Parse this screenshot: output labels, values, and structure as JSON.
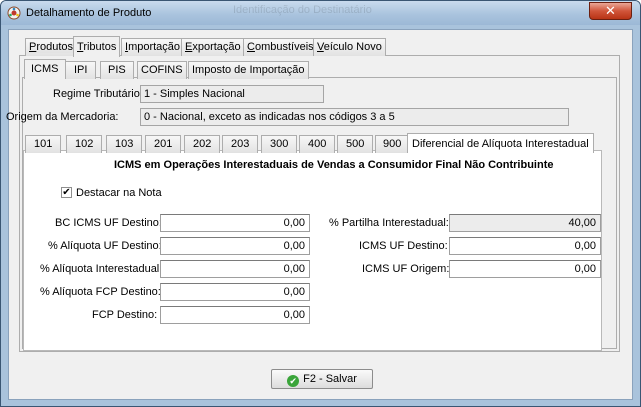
{
  "window": {
    "title": "Detalhamento de Produto",
    "ghost_title": "Identificação do Destinatário",
    "close_glyph": "✕"
  },
  "main_tabs": [
    {
      "label": "Produtos"
    },
    {
      "label": "Tributos"
    },
    {
      "label": "Importação"
    },
    {
      "label": "Exportação"
    },
    {
      "label": "Combustíveis"
    },
    {
      "label": "Veículo Novo"
    }
  ],
  "tax_tabs": [
    {
      "label": "ICMS"
    },
    {
      "label": "IPI"
    },
    {
      "label": "PIS"
    },
    {
      "label": "COFINS"
    },
    {
      "label": "Imposto de Importação"
    }
  ],
  "regime": {
    "label": "Regime Tributário:",
    "value": "1 - Simples Nacional"
  },
  "origem": {
    "label": "Origem da Mercadoria:",
    "value": "0 - Nacional, exceto as indicadas nos códigos 3 a 5"
  },
  "csosn_tabs": [
    {
      "label": "101"
    },
    {
      "label": "102"
    },
    {
      "label": "103"
    },
    {
      "label": "201"
    },
    {
      "label": "202"
    },
    {
      "label": "203"
    },
    {
      "label": "300"
    },
    {
      "label": "400"
    },
    {
      "label": "500"
    },
    {
      "label": "900"
    },
    {
      "label": "Diferencial de Alíquota Interestadual"
    }
  ],
  "difal": {
    "title": "ICMS em Operações Interestaduais de Vendas a Consumidor Final Não Contribuinte",
    "destacar_label": "Destacar na Nota",
    "destacar_checked": "✔",
    "left_fields": [
      {
        "label": "BC ICMS UF Destino:",
        "value": "0,00"
      },
      {
        "label": "% Alíquota UF Destino:",
        "value": "0,00"
      },
      {
        "label": "% Alíquota Interestadual:",
        "value": "0,00"
      },
      {
        "label": "% Alíquota FCP Destino:",
        "value": "0,00"
      },
      {
        "label": "FCP Destino:",
        "value": "0,00"
      }
    ],
    "right_fields": [
      {
        "label": "% Partilha Interestadual:",
        "value": "40,00"
      },
      {
        "label": "ICMS UF Destino:",
        "value": "0,00"
      },
      {
        "label": "ICMS UF Origem:",
        "value": "0,00"
      }
    ]
  },
  "save_button": {
    "label": "F2 - Salvar",
    "icon": "check-circle-icon",
    "icon_glyph": "✔"
  }
}
